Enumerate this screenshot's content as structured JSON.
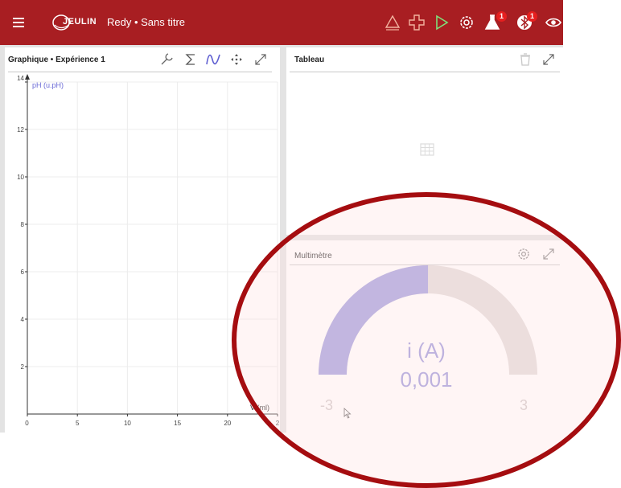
{
  "topbar": {
    "title": "Redy • Sans titre",
    "logo_text": "JEULIN",
    "icons": [
      "menu-icon",
      "triangle-icon",
      "add-icon",
      "play-icon",
      "settings-icon",
      "flask-icon",
      "bluetooth-icon",
      "eye-icon"
    ],
    "flask_badge": "1",
    "bluetooth_badge": "1",
    "bg_color": "#a81e22"
  },
  "graph_panel": {
    "title": "Graphique • Expérience 1",
    "icons": [
      "wrench-icon",
      "sigma-icon",
      "wave-icon",
      "move-icon",
      "expand-icon"
    ],
    "chart_data": {
      "type": "line",
      "series": [],
      "xlabel": "V (ml)",
      "ylabel": "pH (u.pH)",
      "xlim": [
        0,
        25
      ],
      "ylim": [
        0,
        14
      ],
      "xticks": [
        "0",
        "5",
        "10",
        "15",
        "20",
        "2"
      ],
      "yticks": [
        "14",
        "12",
        "10",
        "8",
        "6",
        "4",
        "2"
      ],
      "grid": true
    }
  },
  "table_panel": {
    "title": "Tableau",
    "icons": [
      "trash-icon",
      "expand-icon",
      "table-icon"
    ]
  },
  "multimeter_panel": {
    "title": "Multimètre",
    "quantity_label": "i (A)",
    "value_text": "0,001",
    "value": 0.001,
    "min_label": "-3",
    "max_label": "3",
    "range": [
      -3,
      3
    ],
    "fill_color": "#a29fdf",
    "track_color": "#e2dcdb"
  }
}
